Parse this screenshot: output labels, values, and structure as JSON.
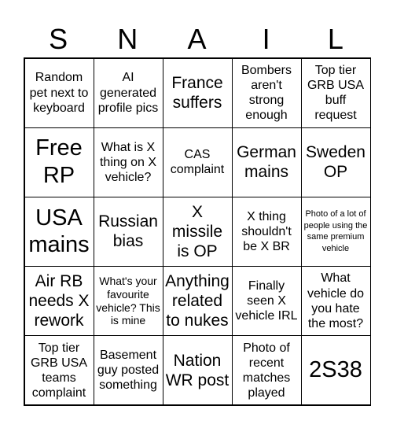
{
  "header": [
    "S",
    "N",
    "A",
    "I",
    "L"
  ],
  "cells": [
    "Random pet next to keyboard",
    "AI generated profile pics",
    "France suffers",
    "Bombers aren't strong enough",
    "Top tier GRB USA buff request",
    "Free RP",
    "What is X thing on X vehicle?",
    "CAS complaint",
    "German mains",
    "Sweden OP",
    "USA mains",
    "Russian bias",
    "X missile is OP",
    "X thing shouldn't be X BR",
    "Photo of a lot of people using the same premium vehicle",
    "Air RB needs X rework",
    "What's your favourite vehicle? This is mine",
    "Anything related to nukes",
    "Finally seen X vehicle IRL",
    "What vehicle do you hate the most?",
    "Top tier GRB USA teams complaint",
    "Basement guy posted something",
    "Nation WR post",
    "Photo of recent matches played",
    "2S38"
  ]
}
